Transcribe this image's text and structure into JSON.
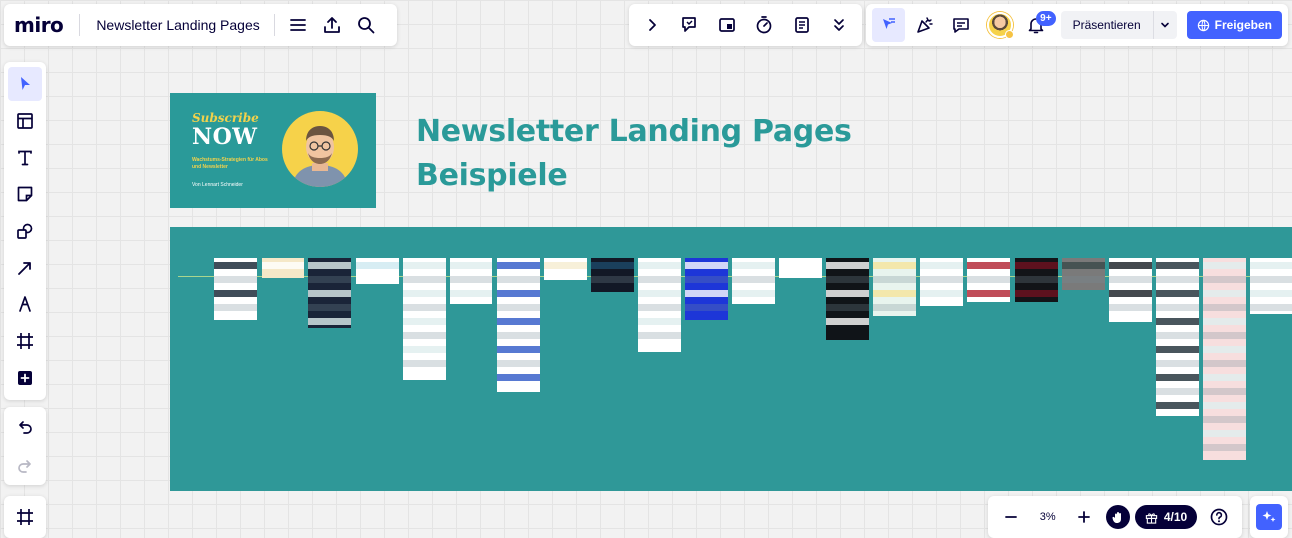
{
  "app": {
    "logo": "miro",
    "board_title": "Newsletter Landing Pages"
  },
  "toolbar_top_right": {
    "notifications_badge": "9+",
    "present_label": "Präsentieren",
    "share_label": "Freigeben"
  },
  "zoom": {
    "level": "3%",
    "tasks_progress": "4/10"
  },
  "canvas": {
    "cover": {
      "title_line1": "Subscribe",
      "title_line2": "NOW",
      "subtitle": "Wachstums-Strategien für Abos und Newsletter",
      "author": "Von Lennart Schneider"
    },
    "heading_line1": "Newsletter Landing Pages",
    "heading_line2": "Beispiele"
  },
  "colors": {
    "accent": "#4262ff",
    "teal": "#2a9a99",
    "ink": "#050038",
    "yellow": "#f2d24b"
  },
  "icons": {
    "menu": "menu-icon",
    "export": "upload-icon",
    "search": "search-icon",
    "select": "cursor-icon",
    "templates": "layout-icon",
    "text": "text-icon",
    "sticky": "sticky-note-icon",
    "shapes": "shapes-icon",
    "arrow": "arrow-icon",
    "pen": "pen-icon",
    "frame": "frame-icon",
    "add": "plus-square-icon",
    "undo": "undo-icon",
    "redo": "redo-icon"
  }
}
